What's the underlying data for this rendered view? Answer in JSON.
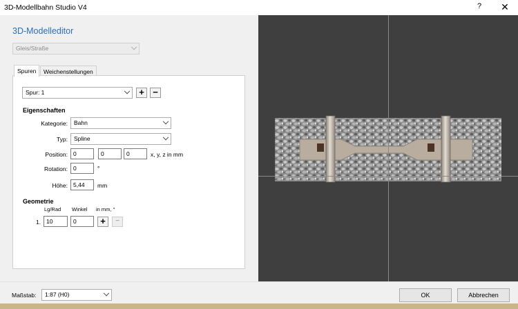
{
  "window": {
    "title": "3D-Modellbahn Studio V4",
    "help_label": "?",
    "close_label": "✕"
  },
  "editor": {
    "heading": "3D-Modelleditor",
    "category_select": "Gleis/Straße"
  },
  "tabs": [
    "Spuren",
    "Weichenstellungen"
  ],
  "track": {
    "select": "Spur: 1",
    "add": "+",
    "remove": "−"
  },
  "properties": {
    "heading": "Eigenschaften",
    "category_label": "Kategorie:",
    "category_value": "Bahn",
    "type_label": "Typ:",
    "type_value": "Spline",
    "position_label": "Position:",
    "position_x": "0",
    "position_y": "0",
    "position_z": "0",
    "position_unit": "x, y, z in mm",
    "rotation_label": "Rotation:",
    "rotation_value": "0",
    "rotation_unit": "°",
    "height_label": "Höhe:",
    "height_value": "5,44",
    "height_unit": "mm"
  },
  "geometry": {
    "heading": "Geometrie",
    "col1": "Lg/Rad",
    "col2": "Winkel",
    "col3": "in mm, °",
    "row_index": "1.",
    "length": "10",
    "angle": "0",
    "add": "+",
    "remove": "−"
  },
  "footer": {
    "scale_label": "Maßstab:",
    "scale_value": "1:87 (H0)",
    "ok": "OK",
    "cancel": "Abbrechen"
  },
  "colors": {
    "heading": "#2a6fb8",
    "preview_bg": "#3f3f3f",
    "ballast": "#8a8a8a",
    "sleeper": "#b9ada0",
    "rail": "#d4ccc3"
  }
}
